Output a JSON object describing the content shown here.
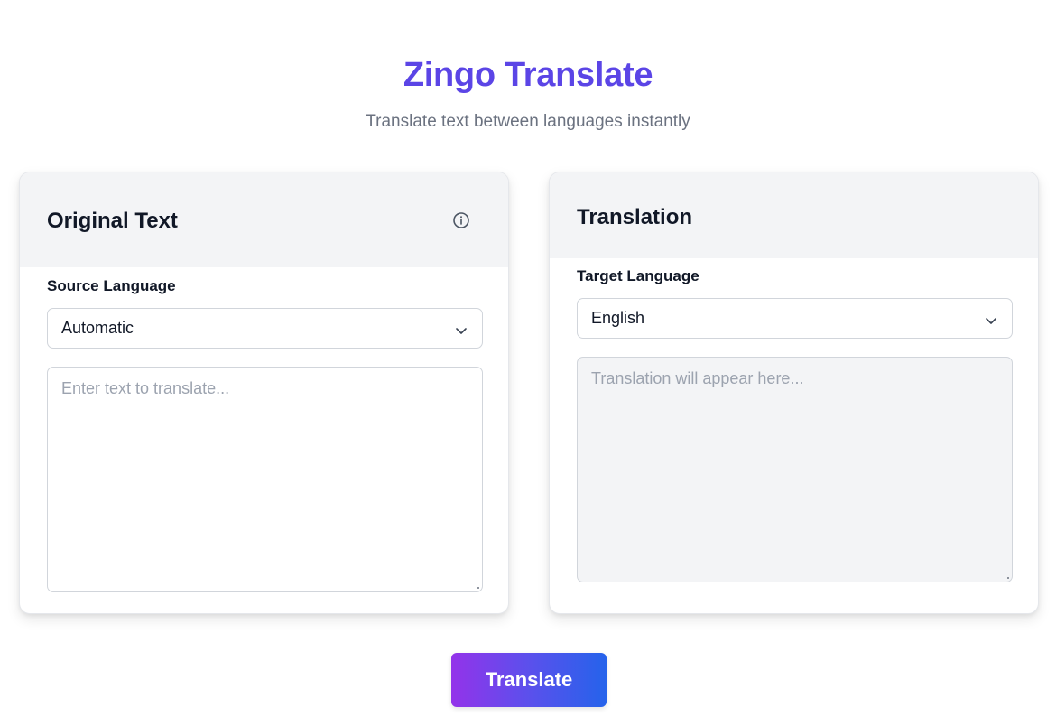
{
  "header": {
    "title": "Zingo Translate",
    "subtitle": "Translate text between languages instantly"
  },
  "source_panel": {
    "title": "Original Text",
    "info_icon": "info-circle-icon",
    "language_label": "Source Language",
    "language_value": "Automatic",
    "input_placeholder": "Enter text to translate..."
  },
  "target_panel": {
    "title": "Translation",
    "language_label": "Target Language",
    "language_value": "English",
    "output_placeholder": "Translation will appear here..."
  },
  "actions": {
    "translate_label": "Translate"
  },
  "colors": {
    "brand": "#5b45e6",
    "button_gradient_start": "#9333ea",
    "button_gradient_end": "#2563eb"
  }
}
